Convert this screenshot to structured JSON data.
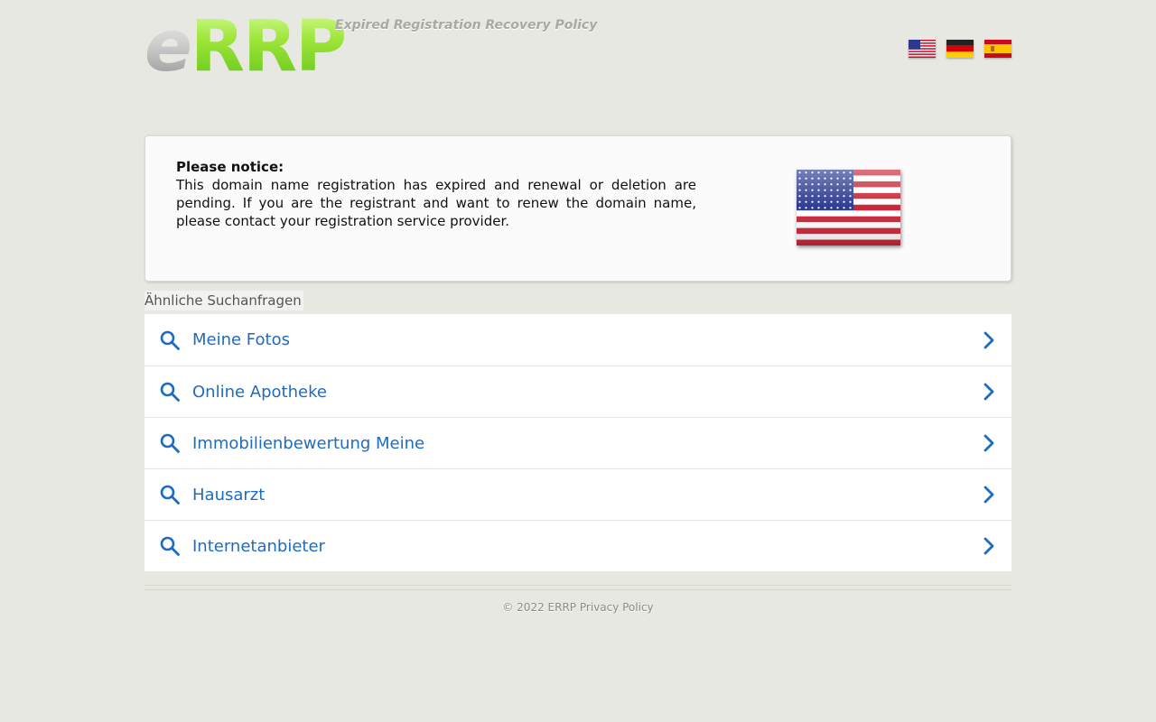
{
  "header": {
    "logo_e": "e",
    "logo_rrp": "RRP",
    "tagline": "Expired Registration Recovery Policy",
    "languages": [
      {
        "name": "English",
        "icon": "us-flag-icon"
      },
      {
        "name": "Deutsch",
        "icon": "de-flag-icon"
      },
      {
        "name": "Español",
        "icon": "es-flag-icon"
      }
    ]
  },
  "notice": {
    "heading": "Please notice:",
    "body": "This domain name registration has expired and renewal or deletion are pending. If you are the registrant and want to renew the domain name, please contact your registration service provider.",
    "flag_icon": "us-flag-icon"
  },
  "related": {
    "title": "Ähnliche Suchanfragen",
    "items": [
      {
        "label": "Meine Fotos"
      },
      {
        "label": "Online Apotheke"
      },
      {
        "label": "Immobilienbewertung Meine"
      },
      {
        "label": "Hausarzt"
      },
      {
        "label": "Internetanbieter"
      }
    ]
  },
  "footer": {
    "copyright": "© 2022 ERRP",
    "privacy": "Privacy Policy"
  },
  "colors": {
    "background": "#e8e8e3",
    "link_blue": "#1e6cc0",
    "logo_green": "#7ed321"
  }
}
